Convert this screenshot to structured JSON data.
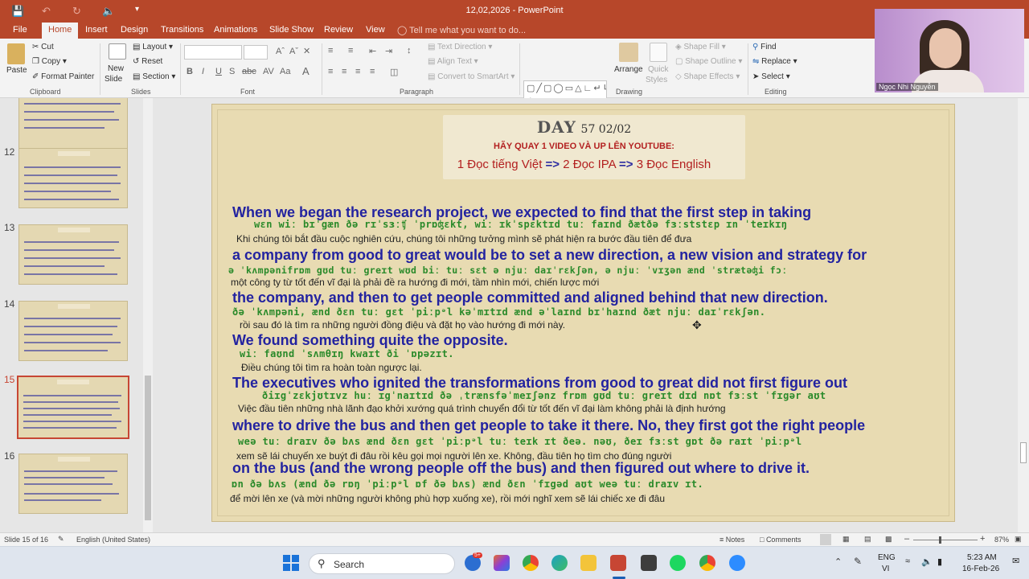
{
  "window": {
    "title": "12,02,2026 - PowerPoint"
  },
  "tabs": [
    "File",
    "Home",
    "Insert",
    "Design",
    "Transitions",
    "Animations",
    "Slide Show",
    "Review",
    "View"
  ],
  "tell_me": "Tell me what you want to do...",
  "ribbon": {
    "clipboard": {
      "paste": "Paste",
      "cut": "Cut",
      "copy": "Copy",
      "format_painter": "Format Painter",
      "label": "Clipboard"
    },
    "slides": {
      "new_slide_1": "New",
      "new_slide_2": "Slide",
      "layout": "Layout",
      "reset": "Reset",
      "section": "Section",
      "label": "Slides"
    },
    "font": {
      "label": "Font"
    },
    "paragraph": {
      "text_direction": "Text Direction",
      "align_text": "Align Text",
      "convert_smartart": "Convert to SmartArt",
      "label": "Paragraph"
    },
    "drawing": {
      "arrange": "Arrange",
      "quick_styles_1": "Quick",
      "quick_styles_2": "Styles",
      "shape_fill": "Shape Fill",
      "shape_outline": "Shape Outline",
      "shape_effects": "Shape Effects",
      "label": "Drawing"
    },
    "editing": {
      "find": "Find",
      "replace": "Replace",
      "select": "Select",
      "label": "Editing"
    }
  },
  "thumbnails": {
    "numbers": [
      "12",
      "13",
      "14",
      "15",
      "16"
    ],
    "selected": "15"
  },
  "webcam": {
    "name": "Ngọc Nhi Nguyễn"
  },
  "slide": {
    "day_label": "DAY",
    "day_num": "57 02/02",
    "instruction": "HÃY QUAY 1 VIDEO VÀ UP LÊN YOUTUBE:",
    "steps": {
      "s1": "1 Đọc tiếng Việt",
      "s2": "2 Đọc IPA",
      "s3": "3 Đọc English",
      "arrow": "=>"
    },
    "lines": [
      {
        "en": "When we began the research project, we expected to find that the first step in taking",
        "ipa": "wɛn wiː bɪˈgæn ðə rɪˈsɜːʧ ˈprɒʤɛkt, wiː ɪkˈspɛktɪd tuː faɪnd ðætðə fɜːststɛp ɪn ˈteɪkɪŋ",
        "vi": "Khi chúng tôi bắt đầu cuộc nghiên cứu, chúng tôi những tưởng mình sẽ phát hiện ra bước đầu tiên để đưa"
      },
      {
        "en": "a company from good to great would be to set a new direction, a new vision and strategy for",
        "ipa": "ə ˈkʌmpənifrɒm gʊd tuː greɪt wʊd biː tuː sɛt ə njuː daɪˈrɛkʃən, ə njuː ˈvɪʒən ænd ˈstrætəʤi fɔː",
        "vi": "một công ty từ tốt đến vĩ đại là phải đề ra hướng đi mới, tầm nhìn mới, chiến lược mới"
      },
      {
        "en": "the company, and then to get people committed and aligned behind that new direction.",
        "ipa": "ðə ˈkʌmpəni, ænd ðɛn tuː gɛt ˈpiːpᵊl kəˈmɪtɪd ænd əˈlaɪnd bɪˈhaɪnd ðæt njuː daɪˈrɛkʃən.",
        "vi": "rồi sau đó là tìm ra những người đồng điệu và đặt họ vào hướng đi mới này."
      },
      {
        "en": "We found something quite the opposite.",
        "ipa": "wiː faʊnd ˈsʌmθɪŋ kwaɪt ði ˈɒpəzɪt.",
        "vi": "Điều chúng tôi tìm ra hoàn toàn ngược lại."
      },
      {
        "en": "The executives who ignited the transformations from good to great did not first figure out",
        "ipa": "ðiɪgˈzɛkjʊtɪvz huː ɪgˈnaɪtɪd ðə ˌtrænsfəˈmeɪʃənz frɒm gʊd tuː greɪt dɪd nɒt fɜːst ˈfɪgər aʊt",
        "vi": "Việc đầu tiên những nhà lãnh đạo khởi xướng quá trình chuyển đổi từ tốt đến vĩ đại làm không phải là định hướng"
      },
      {
        "en": "where to drive the bus and then get people to take it there. No, they first got the right people",
        "ipa": "weə tuː draɪv ðə bʌs ænd ðɛn gɛt ˈpiːpᵊl tuː teɪk ɪt ðeə. nəʊ, ðeɪ fɜːst gɒt ðə raɪt ˈpiːpᵊl",
        "vi": "xem sẽ lái chuyến xe buýt đi đâu rồi kêu gọi mọi người lên xe. Không, đầu tiên họ tìm cho đúng người"
      },
      {
        "en": "on the bus (and the wrong people off the bus) and then figured out where to drive it.",
        "ipa": "ɒn ðə bʌs (ænd ðə rɒŋ ˈpiːpᵊl ɒf ðə bʌs) ænd ðɛn ˈfɪgəd aʊt weə tuː draɪv ɪt.",
        "vi": "để mời lên xe (và mời những người không phù hợp xuống xe), rồi mới nghĩ xem sẽ lái chiếc xe đi đâu"
      }
    ]
  },
  "status": {
    "slide_info": "Slide 15 of 16",
    "language": "English (United States)",
    "notes": "Notes",
    "comments": "Comments",
    "zoom": "87%"
  },
  "taskbar": {
    "search": "Search",
    "lang1": "ENG",
    "lang2": "VI",
    "time": "5:23 AM",
    "date": "16-Feb-26",
    "badge": "5+"
  }
}
